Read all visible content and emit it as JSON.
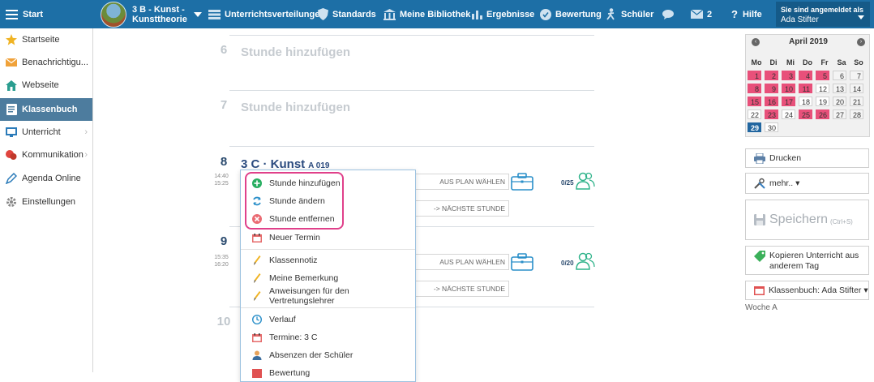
{
  "topbar": {
    "start_label": "Start",
    "class_line1": "3 B - Kunst -",
    "class_line2": "Kunsttheorie",
    "nav": [
      {
        "label": "Unterrichtsverteilungen",
        "icon": "distribution-icon"
      },
      {
        "label": "Standards",
        "icon": "shield-icon"
      },
      {
        "label": "Meine Bibliothek",
        "icon": "library-icon"
      },
      {
        "label": "Ergebnisse",
        "icon": "bar-chart-icon"
      },
      {
        "label": "Bewertung",
        "icon": "grade-icon"
      },
      {
        "label": "Schüler",
        "icon": "students-icon"
      }
    ],
    "chat_icon": "chat-icon",
    "mail_count": "2",
    "help_label": "Hilfe",
    "login_line1": "Sie sind angemeldet als",
    "login_user": "Ada Stifter"
  },
  "sidebar": {
    "items": [
      {
        "label": "Startseite",
        "icon": "star-icon"
      },
      {
        "label": "Benachrichtigu...",
        "icon": "envelope-icon"
      },
      {
        "label": "Webseite",
        "icon": "home-icon"
      },
      {
        "label": "Klassenbuch",
        "icon": "book-icon"
      },
      {
        "label": "Unterricht",
        "icon": "teaching-icon"
      },
      {
        "label": "Kommunikation",
        "icon": "speech-icon"
      },
      {
        "label": "Agenda Online",
        "icon": "pen-icon"
      },
      {
        "label": "Einstellungen",
        "icon": "gear-icon"
      }
    ]
  },
  "periods": [
    {
      "number": "6",
      "add_label": "Stunde hinzufügen"
    },
    {
      "number": "7",
      "add_label": "Stunde hinzufügen"
    },
    {
      "number": "8",
      "time_start": "14:40",
      "time_end": "15:25",
      "title": "3 C · Kunst",
      "room": "A 019",
      "plan_button": "AUS PLAN WÄHLEN",
      "next_button": "-> NÄCHSTE STUNDE",
      "count": "0/25"
    },
    {
      "number": "9",
      "time_start": "15:35",
      "time_end": "16:20",
      "plan_button": "AUS PLAN WÄHLEN",
      "next_button": "-> NÄCHSTE STUNDE",
      "count": "0/20"
    },
    {
      "number": "10"
    }
  ],
  "context_menu": {
    "items": [
      {
        "label": "Stunde hinzufügen",
        "icon": "plus-circle-icon"
      },
      {
        "label": "Stunde ändern",
        "icon": "refresh-icon"
      },
      {
        "label": "Stunde entfernen",
        "icon": "remove-circle-icon"
      },
      {
        "label": "Neuer Termin",
        "icon": "calendar-icon"
      },
      {
        "label": "Klassennotiz",
        "icon": "pencil-icon"
      },
      {
        "label": "Meine Bemerkung",
        "icon": "pencil-icon"
      },
      {
        "label": "Anweisungen für den Vertretungslehrer",
        "icon": "pencil-icon"
      },
      {
        "label": "Verlauf",
        "icon": "clock-icon"
      },
      {
        "label": "Termine: 3 C",
        "icon": "calendar-icon"
      },
      {
        "label": "Absenzen der Schüler",
        "icon": "person-icon"
      },
      {
        "label": "Bewertung",
        "icon": "grade-icon"
      }
    ]
  },
  "calendar": {
    "month": "April 2019",
    "weekdays": [
      "Mo",
      "Di",
      "Mi",
      "Do",
      "Fr",
      "Sa",
      "So"
    ],
    "weeks": [
      [
        {
          "d": "1",
          "s": "pink"
        },
        {
          "d": "2",
          "s": "pink"
        },
        {
          "d": "3",
          "s": "pink"
        },
        {
          "d": "4",
          "s": "pink"
        },
        {
          "d": "5",
          "s": "pink"
        },
        {
          "d": "6",
          "s": "gray"
        },
        {
          "d": "7",
          "s": "gray"
        }
      ],
      [
        {
          "d": "8",
          "s": "pink"
        },
        {
          "d": "9",
          "s": "pink"
        },
        {
          "d": "10",
          "s": "pink"
        },
        {
          "d": "11",
          "s": "pink"
        },
        {
          "d": "12",
          "s": "white"
        },
        {
          "d": "13",
          "s": "gray"
        },
        {
          "d": "14",
          "s": "gray"
        }
      ],
      [
        {
          "d": "15",
          "s": "pink"
        },
        {
          "d": "16",
          "s": "pink"
        },
        {
          "d": "17",
          "s": "pink"
        },
        {
          "d": "18",
          "s": "white"
        },
        {
          "d": "19",
          "s": "white"
        },
        {
          "d": "20",
          "s": "gray"
        },
        {
          "d": "21",
          "s": "gray"
        }
      ],
      [
        {
          "d": "22",
          "s": "white"
        },
        {
          "d": "23",
          "s": "pink"
        },
        {
          "d": "24",
          "s": "white"
        },
        {
          "d": "25",
          "s": "pink"
        },
        {
          "d": "26",
          "s": "pink"
        },
        {
          "d": "27",
          "s": "gray"
        },
        {
          "d": "28",
          "s": "gray"
        }
      ],
      [
        {
          "d": "29",
          "s": "today"
        },
        {
          "d": "30",
          "s": "white"
        }
      ]
    ]
  },
  "right_panel": {
    "print_label": "Drucken",
    "more_label": "mehr.. ▾",
    "save_label": "Speichern",
    "save_shortcut": "(Ctrl+S)",
    "copy_label_1": "Kopieren Unterricht aus",
    "copy_label_2": "anderem Tag",
    "classbook_label": "Klassenbuch: Ada Stifter ▾",
    "week_label": "Woche A"
  },
  "colors": {
    "topbar": "#1d6fa6",
    "active_sidebar": "#4d7c9e",
    "highlight": "#e0408a",
    "calendar_pink": "#e8507a",
    "today": "#2166a0"
  }
}
